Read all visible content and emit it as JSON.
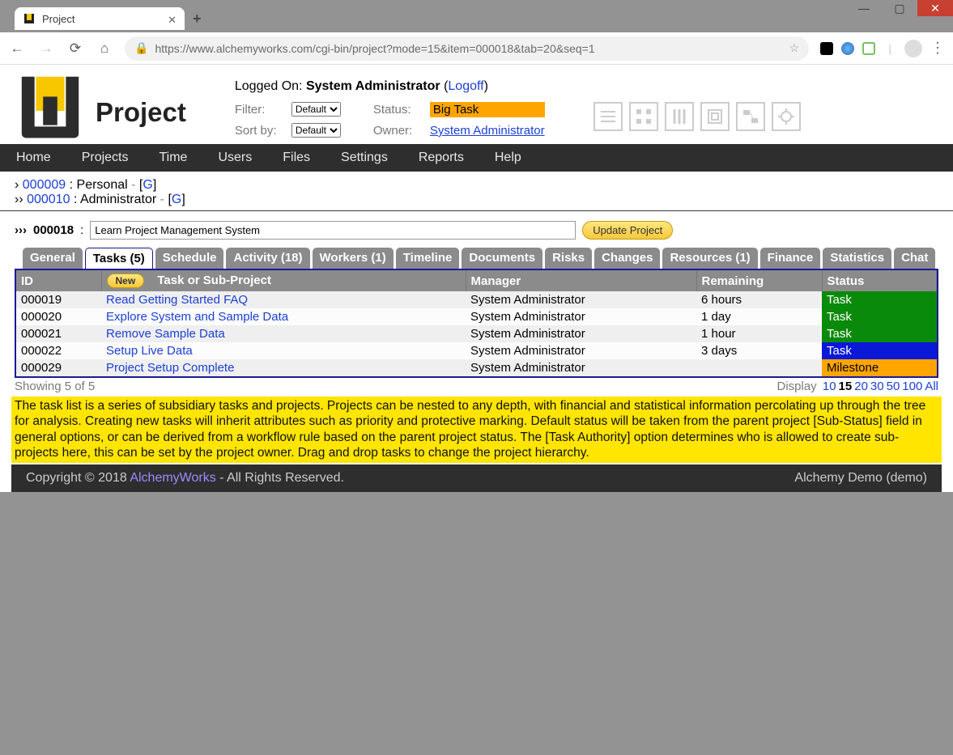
{
  "browser": {
    "tab_title": "Project",
    "url": "https://www.alchemyworks.com/cgi-bin/project?mode=15&item=000018&tab=20&seq=1"
  },
  "header": {
    "app_title": "Project",
    "logged_on_label": "Logged On:",
    "logged_on_user": "System Administrator",
    "logoff_label": "Logoff",
    "filter_label": "Filter:",
    "filter_value": "Default",
    "sortby_label": "Sort by:",
    "sortby_value": "Default",
    "status_label": "Status:",
    "status_value": "Big Task",
    "owner_label": "Owner:",
    "owner_value": "System Administrator"
  },
  "nav": [
    "Home",
    "Projects",
    "Time",
    "Users",
    "Files",
    "Settings",
    "Reports",
    "Help"
  ],
  "breadcrumb": {
    "l1": {
      "chev": "›",
      "id": "000009",
      "name": "Personal",
      "g": "G"
    },
    "l2": {
      "chev": "››",
      "id": "000010",
      "name": "Administrator",
      "g": "G"
    }
  },
  "project": {
    "chev": "›››",
    "id": "000018",
    "name": "Learn Project Management System",
    "update_label": "Update Project"
  },
  "subtabs": [
    "General",
    "Tasks (5)",
    "Schedule",
    "Activity (18)",
    "Workers (1)",
    "Timeline",
    "Documents",
    "Risks",
    "Changes",
    "Resources (1)",
    "Finance",
    "Statistics",
    "Chat"
  ],
  "active_tab": 1,
  "table": {
    "new_label": "New",
    "cols": [
      "ID",
      "Task or Sub-Project",
      "Manager",
      "Remaining",
      "Status"
    ],
    "rows": [
      {
        "id": "000019",
        "task": "Read Getting Started FAQ",
        "manager": "System Administrator",
        "remaining": "6 hours",
        "status": "Task",
        "status_class": "status-task"
      },
      {
        "id": "000020",
        "task": "Explore System and Sample Data",
        "manager": "System Administrator",
        "remaining": "1 day",
        "status": "Task",
        "status_class": "status-task"
      },
      {
        "id": "000021",
        "task": "Remove Sample Data",
        "manager": "System Administrator",
        "remaining": "1 hour",
        "status": "Task",
        "status_class": "status-task"
      },
      {
        "id": "000022",
        "task": "Setup Live Data",
        "manager": "System Administrator",
        "remaining": "3 days",
        "status": "Task",
        "status_class": "status-task-blue"
      },
      {
        "id": "000029",
        "task": "Project Setup Complete",
        "manager": "System Administrator",
        "remaining": "",
        "status": "Milestone",
        "status_class": "status-milestone"
      }
    ]
  },
  "showing": {
    "text": "Showing 5 of 5",
    "display_label": "Display",
    "options": [
      "10",
      "15",
      "20",
      "30",
      "50",
      "100",
      "All"
    ],
    "current": "15"
  },
  "info_text": "The task list is a series of subsidiary tasks and projects. Projects can be nested to any depth, with financial and statistical information percolating up through the tree for analysis. Creating new tasks will inherit attributes such as priority and protective marking. Default status will be taken from the parent project [Sub-Status] field in general options, or can be derived from a workflow rule based on the parent project status. The [Task Authority] option determines who is allowed to create sub-projects here, this can be set by the project owner. Drag and drop tasks to change the project hierarchy.",
  "footer": {
    "copyright": "Copyright © 2018 ",
    "brand": "AlchemyWorks",
    "rights": " - All Rights Reserved.",
    "right": "Alchemy Demo (demo)"
  }
}
